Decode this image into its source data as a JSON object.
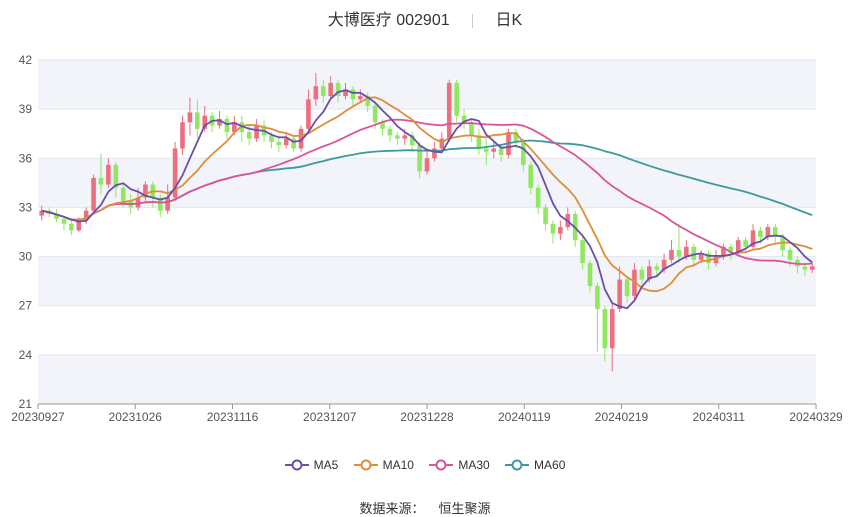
{
  "header": {
    "stock_title": "大博医疗 002901",
    "period": "日K"
  },
  "source": {
    "label": "数据来源：",
    "value": "恒生聚源"
  },
  "colors": {
    "up": "#ec6e7f",
    "down": "#8ee860",
    "ma5": "#6a4fa8",
    "ma10": "#e08c3a",
    "ma30": "#d9559a",
    "ma60": "#3a9aa0",
    "band": "#f2f4fa",
    "grid": "#e3e6ef"
  },
  "chart_data": {
    "type": "candlestick",
    "ylim": [
      21,
      42
    ],
    "yticks": [
      21,
      24,
      27,
      30,
      33,
      36,
      39,
      42
    ],
    "xticks": [
      "20230927",
      "20231026",
      "20231116",
      "20231207",
      "20231228",
      "20240119",
      "20240219",
      "20240311",
      "20240329"
    ],
    "legend": [
      "MA5",
      "MA10",
      "MA30",
      "MA60"
    ],
    "candles": [
      [
        32.5,
        32.8,
        32.2,
        33.1
      ],
      [
        32.8,
        32.6,
        32.4,
        33.0
      ],
      [
        32.6,
        32.3,
        32.1,
        32.9
      ],
      [
        32.3,
        32.0,
        31.6,
        32.5
      ],
      [
        32.0,
        31.6,
        31.3,
        32.2
      ],
      [
        31.6,
        32.2,
        31.5,
        32.4
      ],
      [
        32.2,
        32.8,
        32.0,
        33.0
      ],
      [
        32.8,
        34.8,
        32.7,
        35.0
      ],
      [
        34.8,
        34.4,
        33.8,
        36.3
      ],
      [
        34.4,
        35.6,
        34.2,
        36.0
      ],
      [
        35.6,
        34.2,
        33.6,
        35.8
      ],
      [
        34.2,
        33.4,
        33.0,
        34.4
      ],
      [
        33.4,
        33.0,
        32.6,
        33.8
      ],
      [
        33.0,
        33.6,
        32.8,
        34.2
      ],
      [
        33.6,
        34.4,
        33.4,
        34.6
      ],
      [
        34.4,
        33.6,
        33.0,
        34.6
      ],
      [
        33.6,
        32.8,
        32.4,
        33.8
      ],
      [
        32.8,
        33.6,
        32.6,
        34.4
      ],
      [
        33.6,
        36.6,
        33.4,
        37.0
      ],
      [
        36.6,
        38.2,
        36.2,
        38.6
      ],
      [
        38.2,
        38.8,
        37.4,
        39.7
      ],
      [
        38.8,
        37.8,
        37.2,
        39.6
      ],
      [
        37.8,
        38.6,
        37.6,
        39.2
      ],
      [
        38.6,
        38.0,
        37.6,
        38.8
      ],
      [
        38.0,
        38.4,
        37.8,
        38.9
      ],
      [
        38.4,
        37.6,
        37.2,
        38.6
      ],
      [
        37.6,
        38.2,
        37.4,
        38.6
      ],
      [
        38.2,
        37.6,
        37.0,
        38.6
      ],
      [
        37.6,
        37.2,
        36.8,
        38.0
      ],
      [
        37.2,
        38.0,
        37.0,
        38.4
      ],
      [
        38.0,
        37.4,
        37.0,
        38.3
      ],
      [
        37.4,
        37.0,
        36.6,
        37.6
      ],
      [
        37.0,
        36.8,
        36.4,
        37.4
      ],
      [
        36.8,
        37.2,
        36.6,
        37.6
      ],
      [
        37.2,
        36.6,
        36.4,
        37.4
      ],
      [
        36.6,
        37.8,
        36.4,
        38.0
      ],
      [
        37.8,
        39.6,
        37.6,
        40.2
      ],
      [
        39.6,
        40.4,
        39.2,
        41.2
      ],
      [
        40.4,
        39.8,
        39.4,
        40.8
      ],
      [
        39.8,
        40.6,
        39.6,
        41.0
      ],
      [
        40.6,
        39.8,
        39.4,
        40.8
      ],
      [
        39.8,
        40.2,
        39.6,
        40.6
      ],
      [
        40.2,
        39.6,
        39.2,
        40.4
      ],
      [
        39.6,
        39.8,
        39.4,
        40.2
      ],
      [
        39.8,
        39.2,
        38.8,
        40.0
      ],
      [
        39.2,
        38.2,
        37.8,
        39.4
      ],
      [
        38.2,
        37.8,
        37.4,
        38.4
      ],
      [
        37.8,
        37.4,
        37.0,
        38.0
      ],
      [
        37.4,
        37.2,
        36.8,
        37.6
      ],
      [
        37.2,
        37.4,
        36.8,
        37.8
      ],
      [
        37.4,
        36.8,
        36.4,
        37.6
      ],
      [
        36.8,
        35.2,
        34.8,
        37.0
      ],
      [
        35.2,
        36.0,
        35.0,
        36.4
      ],
      [
        36.0,
        36.6,
        35.8,
        37.0
      ],
      [
        36.6,
        37.2,
        36.4,
        37.6
      ],
      [
        37.2,
        40.6,
        37.0,
        40.8
      ],
      [
        40.6,
        38.6,
        38.2,
        40.8
      ],
      [
        38.6,
        38.2,
        37.8,
        39.0
      ],
      [
        38.2,
        37.4,
        37.0,
        38.4
      ],
      [
        37.4,
        36.6,
        36.2,
        37.8
      ],
      [
        36.6,
        36.4,
        35.6,
        37.2
      ],
      [
        36.4,
        36.6,
        36.0,
        37.0
      ],
      [
        36.6,
        36.2,
        35.8,
        36.8
      ],
      [
        36.2,
        37.6,
        36.0,
        37.8
      ],
      [
        37.6,
        37.0,
        36.6,
        37.8
      ],
      [
        37.0,
        35.6,
        35.2,
        37.2
      ],
      [
        35.6,
        34.2,
        33.8,
        35.8
      ],
      [
        34.2,
        33.0,
        32.6,
        34.4
      ],
      [
        33.0,
        32.0,
        31.6,
        33.2
      ],
      [
        32.0,
        31.4,
        30.8,
        32.2
      ],
      [
        31.4,
        31.8,
        31.0,
        32.2
      ],
      [
        31.8,
        32.6,
        31.6,
        33.0
      ],
      [
        32.6,
        31.0,
        30.6,
        32.8
      ],
      [
        31.0,
        29.6,
        29.2,
        31.2
      ],
      [
        29.6,
        28.2,
        27.8,
        29.8
      ],
      [
        28.2,
        26.8,
        24.2,
        28.4
      ],
      [
        26.8,
        24.4,
        23.6,
        27.0
      ],
      [
        24.4,
        26.8,
        23.0,
        27.2
      ],
      [
        26.8,
        28.6,
        26.6,
        29.4
      ],
      [
        28.6,
        27.6,
        27.2,
        28.8
      ],
      [
        27.6,
        29.2,
        27.4,
        29.6
      ],
      [
        29.2,
        28.6,
        28.2,
        29.4
      ],
      [
        28.6,
        29.4,
        28.4,
        29.8
      ],
      [
        29.4,
        29.2,
        28.8,
        29.6
      ],
      [
        29.2,
        29.8,
        29.0,
        30.2
      ],
      [
        29.8,
        30.4,
        29.6,
        31.0
      ],
      [
        30.4,
        30.0,
        29.6,
        32.0
      ],
      [
        30.0,
        30.6,
        29.8,
        31.0
      ],
      [
        30.6,
        29.8,
        29.4,
        30.8
      ],
      [
        29.8,
        30.2,
        29.6,
        30.4
      ],
      [
        30.2,
        29.6,
        29.2,
        30.4
      ],
      [
        29.6,
        30.0,
        29.4,
        30.4
      ],
      [
        30.0,
        30.6,
        29.8,
        30.8
      ],
      [
        30.6,
        30.2,
        29.8,
        30.8
      ],
      [
        30.2,
        31.0,
        30.0,
        31.2
      ],
      [
        31.0,
        30.6,
        30.2,
        31.2
      ],
      [
        30.6,
        31.6,
        30.4,
        32.0
      ],
      [
        31.6,
        31.2,
        30.8,
        31.8
      ],
      [
        31.2,
        31.8,
        31.0,
        32.0
      ],
      [
        31.8,
        31.2,
        30.8,
        32.0
      ],
      [
        31.2,
        30.4,
        30.0,
        31.4
      ],
      [
        30.4,
        29.8,
        29.4,
        30.6
      ],
      [
        29.8,
        29.4,
        29.0,
        30.0
      ],
      [
        29.4,
        29.2,
        28.8,
        29.6
      ],
      [
        29.2,
        29.4,
        29.0,
        29.6
      ]
    ]
  }
}
